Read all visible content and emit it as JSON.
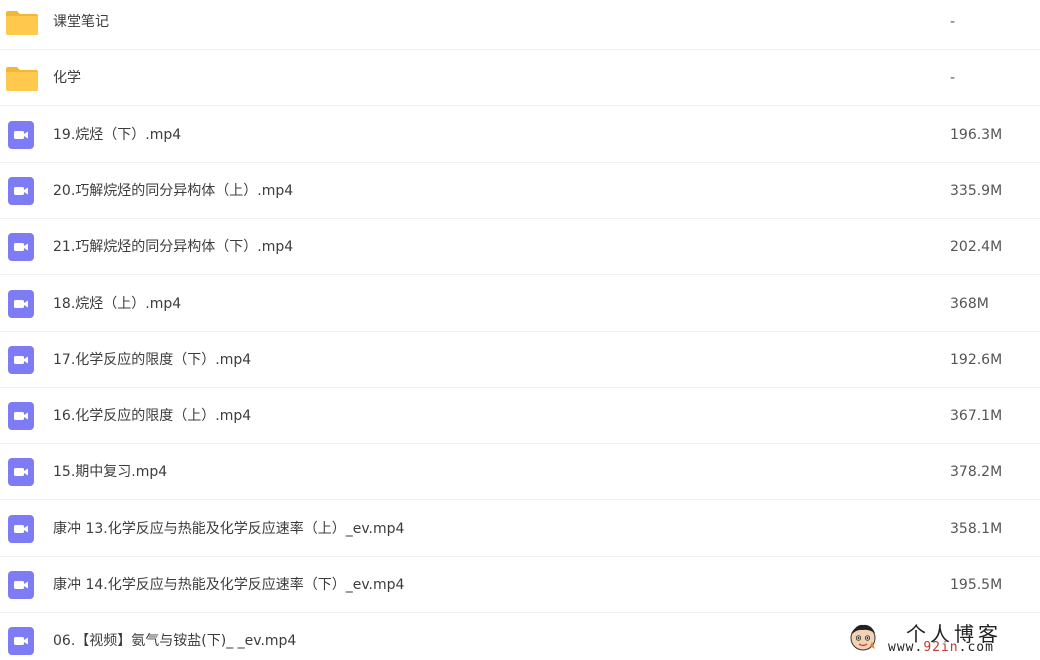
{
  "files": [
    {
      "type": "folder",
      "icon": "folder-icon",
      "name": "课堂笔记",
      "size": "-"
    },
    {
      "type": "folder",
      "icon": "folder-icon",
      "name": "化学",
      "size": "-"
    },
    {
      "type": "video",
      "icon": "video-file-icon",
      "name": "19.烷烃（下）.mp4",
      "size": "196.3M"
    },
    {
      "type": "video",
      "icon": "video-file-icon",
      "name": "20.巧解烷烃的同分异构体（上）.mp4",
      "size": "335.9M"
    },
    {
      "type": "video",
      "icon": "video-file-icon",
      "name": "21.巧解烷烃的同分异构体（下）.mp4",
      "size": "202.4M"
    },
    {
      "type": "video",
      "icon": "video-file-icon",
      "name": "18.烷烃（上）.mp4",
      "size": "368M"
    },
    {
      "type": "video",
      "icon": "video-file-icon",
      "name": "17.化学反应的限度（下）.mp4",
      "size": "192.6M"
    },
    {
      "type": "video",
      "icon": "video-file-icon",
      "name": "16.化学反应的限度（上）.mp4",
      "size": "367.1M"
    },
    {
      "type": "video",
      "icon": "video-file-icon",
      "name": "15.期中复习.mp4",
      "size": "378.2M"
    },
    {
      "type": "video",
      "icon": "video-file-icon",
      "name": "康冲 13.化学反应与热能及化学反应速率（上）_ev.mp4",
      "size": "358.1M"
    },
    {
      "type": "video",
      "icon": "video-file-icon",
      "name": "康冲 14.化学反应与热能及化学反应速率（下）_ev.mp4",
      "size": "195.5M"
    },
    {
      "type": "video",
      "icon": "video-file-icon",
      "name": "06.【视频】氨气与铵盐(下)_ _ev.mp4",
      "size": ""
    }
  ],
  "watermark": {
    "title": "个人博客",
    "url_prefix": "www.",
    "url_highlight": "92in",
    "url_suffix": ".com",
    "icon": "cartoon-face-icon"
  },
  "colors": {
    "folder": "#FFC94D",
    "folder_tab": "#F5B731",
    "video": "#7E7CF5",
    "divider": "#EEF0F3"
  }
}
